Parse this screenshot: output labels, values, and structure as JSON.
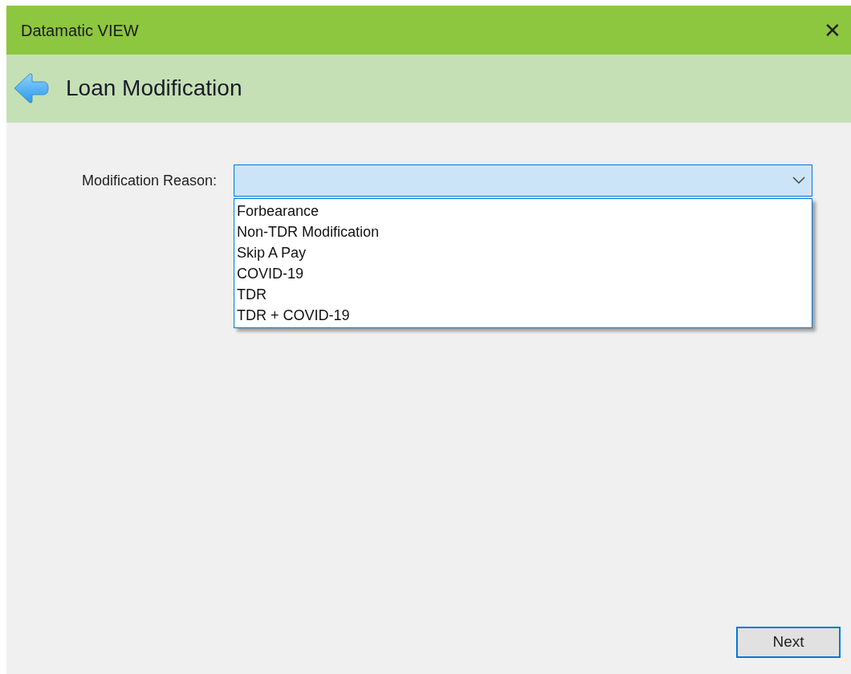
{
  "window": {
    "title": "Datamatic VIEW",
    "close": "✕"
  },
  "header": {
    "title": "Loan Modification"
  },
  "form": {
    "label": "Modification Reason:",
    "combobox": {
      "expanded": true,
      "options": [
        {
          "label": "Forbearance"
        },
        {
          "label": "Non-TDR Modification"
        },
        {
          "label": "Skip A Pay"
        },
        {
          "label": "COVID-19"
        },
        {
          "label": "TDR"
        },
        {
          "label": "TDR + COVID-19"
        }
      ]
    }
  },
  "buttons": [
    {
      "label": "Next"
    }
  ]
}
